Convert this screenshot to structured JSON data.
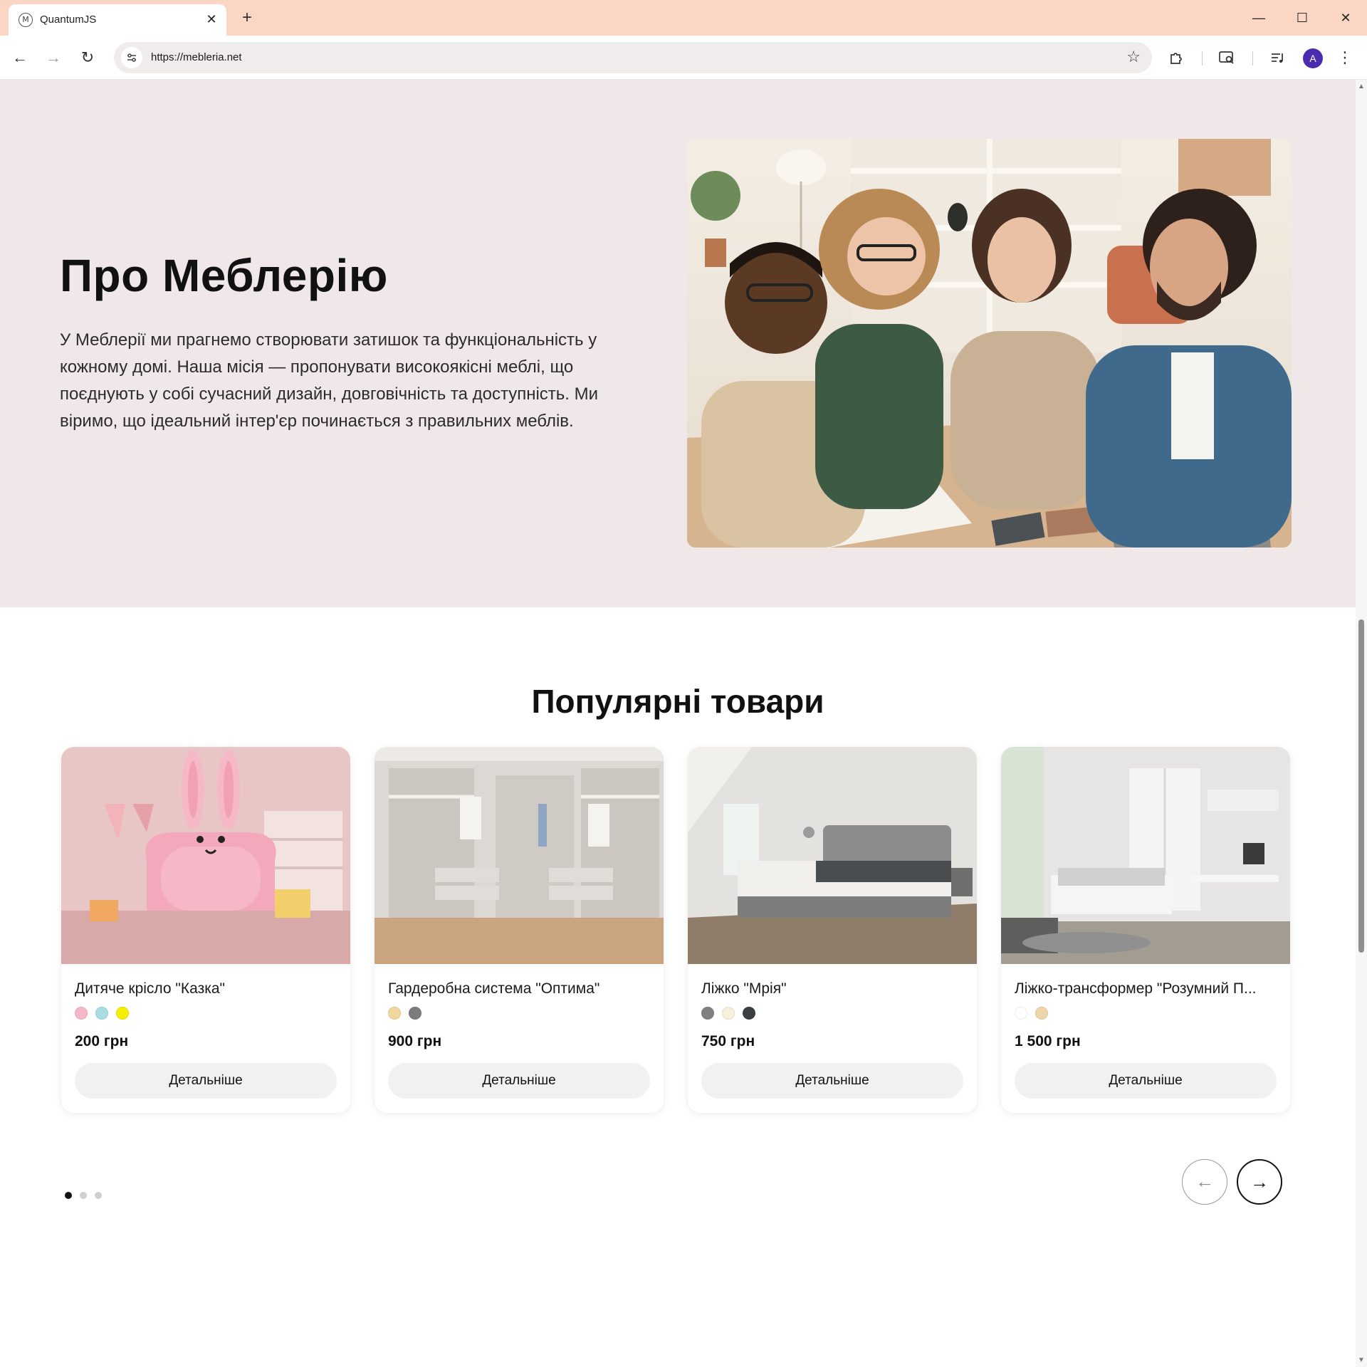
{
  "browser": {
    "tab_title": "QuantumJS",
    "tab_favicon": "M",
    "url": "https://mebleria.net",
    "profile_initial": "A",
    "new_tab": "+",
    "tab_close": "✕",
    "minimize": "—",
    "maximize": "☐",
    "close": "✕",
    "back": "←",
    "forward": "→",
    "reload": "↻",
    "star": "☆"
  },
  "about": {
    "title": "Про Меблерію",
    "text": "У Меблерії ми прагнемо створювати затишок та функціональність у кожному домі. Наша місія — пропонувати високоякісні меблі, що поєднують у собі сучасний дизайн, довговічність та доступність. Ми віримо, що ідеальний інтер'єр починається з правильних меблів."
  },
  "popular": {
    "title": "Популярні товари",
    "products": [
      {
        "name": "Дитяче крісло \"Казка\"",
        "colors": [
          "#f5b8c8",
          "#a8dde3",
          "#f6ee00"
        ],
        "price": "200 грн",
        "button": "Детальніше"
      },
      {
        "name": "Гардеробна система \"Оптима\"",
        "colors": [
          "#f0d7a0",
          "#7c7c7c"
        ],
        "price": "900 грн",
        "button": "Детальніше"
      },
      {
        "name": "Ліжко \"Мрія\"",
        "colors": [
          "#808080",
          "#f4f1dd",
          "#3a3f44"
        ],
        "price": "750 грн",
        "button": "Детальніше"
      },
      {
        "name": "Ліжко-трансформер \"Розумний П...",
        "colors": [
          "#ffffff",
          "#ecd5a8"
        ],
        "price": "1 500 грн",
        "button": "Детальніше"
      }
    ],
    "active_page": 1,
    "pages": 3
  },
  "colors": {
    "tabbar": "#fbd6c5",
    "about_bg": "#f0e8e8",
    "text": "#111111"
  }
}
